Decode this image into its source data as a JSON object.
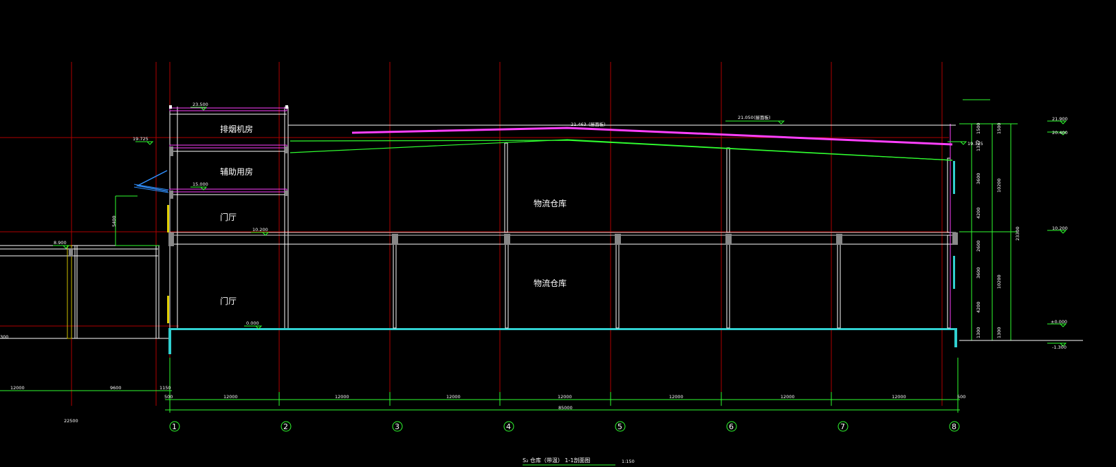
{
  "drawing": {
    "title": "S₂ 仓库（带温） 1-1剖面图",
    "scale": "1:150"
  },
  "rooms": {
    "smoke_room": "排烟机房",
    "aux_room": "辅助用房",
    "hall_upper": "门厅",
    "hall_lower": "门厅",
    "warehouse_upper": "物流仓库",
    "warehouse_lower": "物流仓库"
  },
  "elevations": {
    "top_tower": "23.500",
    "left_19725": "19.725",
    "e15000": "15.000",
    "e10200": "10.200",
    "e0000": "0.000",
    "left_8900": "8.900",
    "left_300": "300",
    "ridge": "21.463",
    "ridge_note": "(屋面板)",
    "roof_21050": "21.050",
    "roof_note": "(屋面板)",
    "right_19": "19.725",
    "right_21900": "21.900",
    "right_20400": "20.400",
    "right_10200": "10.200",
    "right_0000": "±0.000",
    "right_m1300": "-1.300"
  },
  "dims_left": {
    "d12000": "12000",
    "d9600": "9600",
    "d1150": "1150",
    "d500": "500",
    "d22500": "22500",
    "d5400": "5400"
  },
  "dims_bottom": {
    "bays": [
      "12000",
      "12000",
      "12000",
      "12000",
      "12000",
      "12000",
      "12000"
    ],
    "end_left": "500",
    "end_right": "500",
    "total": "85000"
  },
  "dims_right": {
    "a1500": "1500",
    "a1500b": "1500",
    "a1337": "1337",
    "a3600": "3600",
    "a4200": "4200",
    "a10200u": "10200",
    "a2600": "2600",
    "a3600b": "3600",
    "a4200b": "4200",
    "a10200l": "10200",
    "a1300": "1300",
    "a1300b": "1300",
    "total": "23300"
  },
  "axes": [
    "1",
    "2",
    "3",
    "4",
    "5",
    "6",
    "7",
    "8"
  ]
}
